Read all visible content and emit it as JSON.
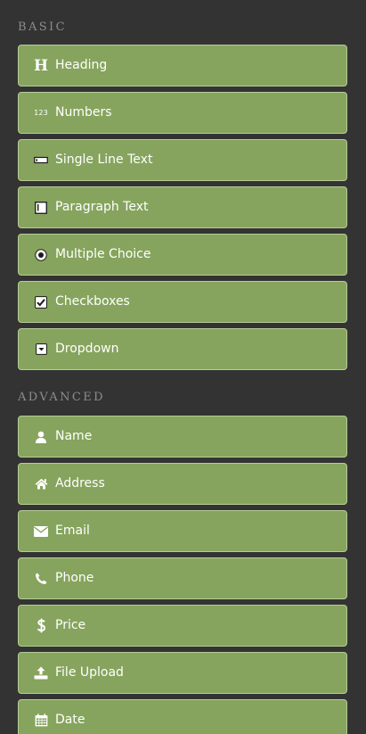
{
  "sections": {
    "basic": {
      "title": "BASIC",
      "items": [
        {
          "label": "Heading",
          "icon": "heading-icon"
        },
        {
          "label": "Numbers",
          "icon": "numbers-icon"
        },
        {
          "label": "Single Line Text",
          "icon": "single-line-text-icon"
        },
        {
          "label": "Paragraph Text",
          "icon": "paragraph-text-icon"
        },
        {
          "label": "Multiple Choice",
          "icon": "radio-icon"
        },
        {
          "label": "Checkboxes",
          "icon": "checkbox-icon"
        },
        {
          "label": "Dropdown",
          "icon": "dropdown-icon"
        }
      ]
    },
    "advanced": {
      "title": "ADVANCED",
      "items": [
        {
          "label": "Name",
          "icon": "user-icon"
        },
        {
          "label": "Address",
          "icon": "home-icon"
        },
        {
          "label": "Email",
          "icon": "envelope-icon"
        },
        {
          "label": "Phone",
          "icon": "phone-icon"
        },
        {
          "label": "Price",
          "icon": "dollar-icon"
        },
        {
          "label": "File Upload",
          "icon": "upload-icon"
        },
        {
          "label": "Date",
          "icon": "calendar-icon"
        }
      ]
    }
  },
  "icon_text": {
    "heading": "H",
    "numbers": "123"
  },
  "colors": {
    "background": "#333333",
    "button": "#86a45d",
    "button_border": "#b7cc97",
    "section_title": "#8c8c8c",
    "text": "#ffffff"
  }
}
